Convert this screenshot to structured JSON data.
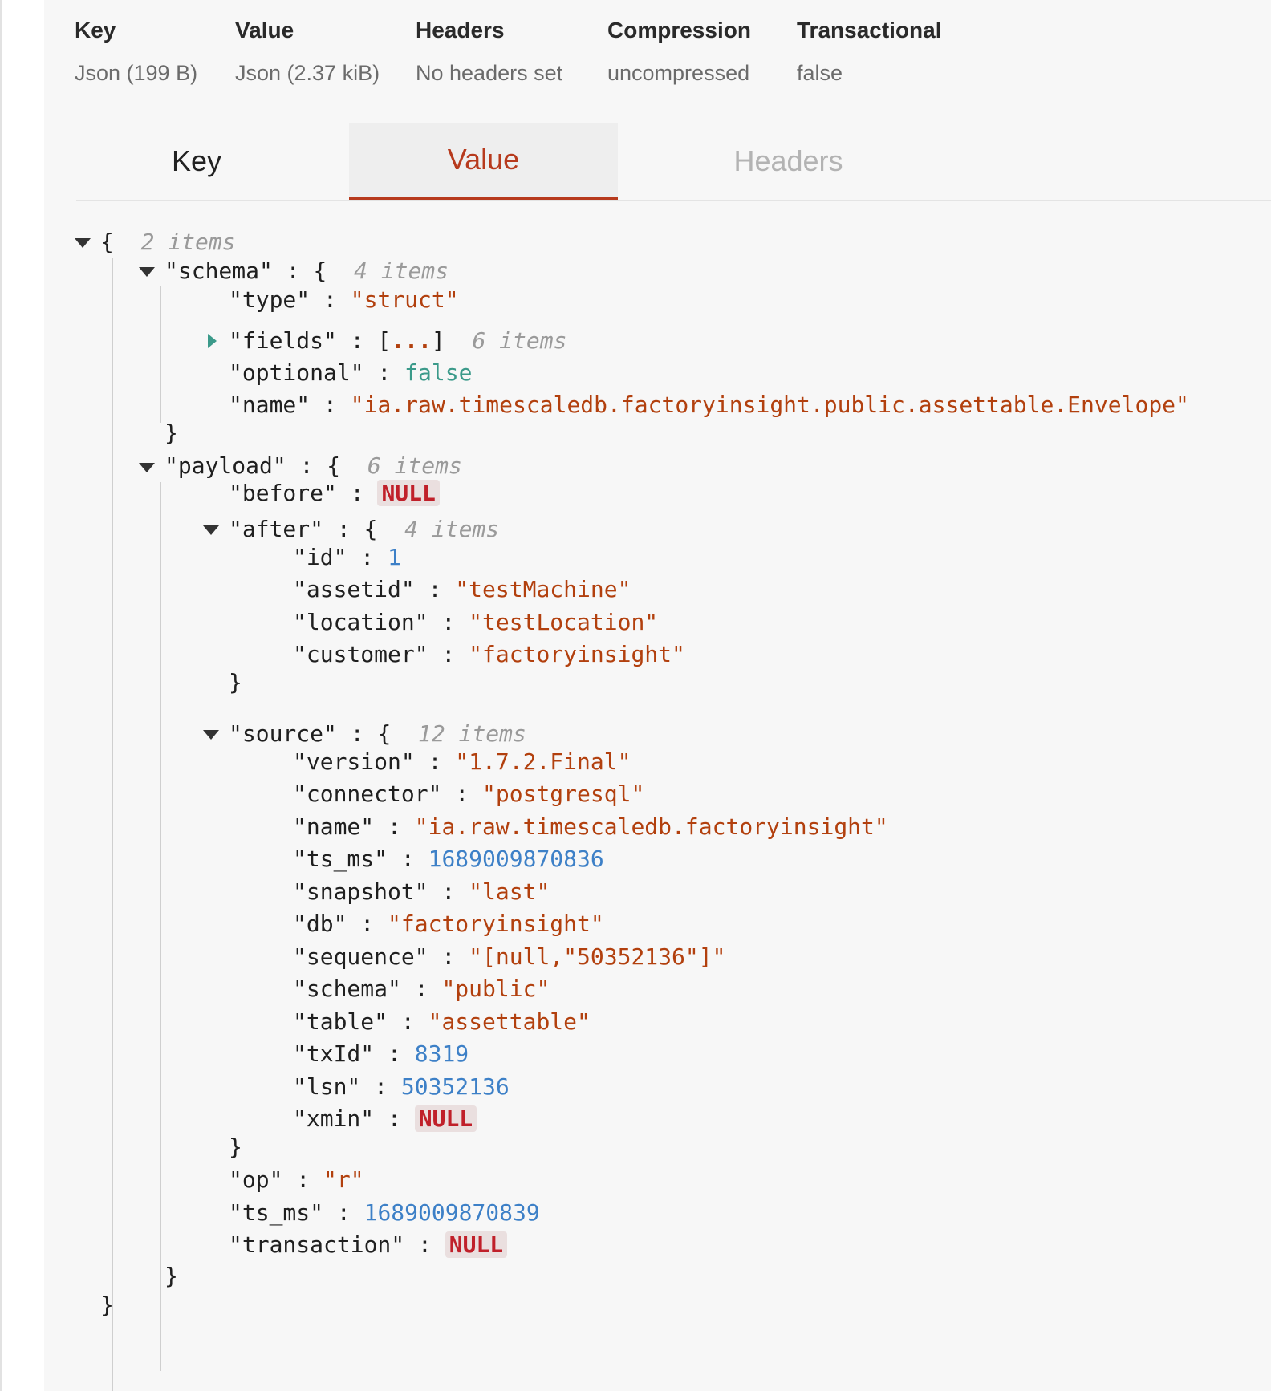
{
  "meta": {
    "columns": [
      {
        "label": "Key",
        "value": "Json (199 B)"
      },
      {
        "label": "Value",
        "value": "Json (2.37 kiB)"
      },
      {
        "label": "Headers",
        "value": "No headers set"
      },
      {
        "label": "Compression",
        "value": "uncompressed"
      },
      {
        "label": "Transactional",
        "value": "false"
      }
    ]
  },
  "tabs": {
    "key_label": "Key",
    "value_label": "Value",
    "headers_label": "Headers",
    "active": "Value"
  },
  "tree": {
    "root": {
      "open": "{",
      "count": "2 items",
      "close": "}"
    },
    "schema": {
      "key": "\"schema\"",
      "open": "{",
      "count": "4 items",
      "close": "}",
      "type_key": "\"type\"",
      "type_val": "\"struct\"",
      "fields_key": "\"fields\"",
      "fields_val": "...",
      "fields_count": "6 items",
      "optional_key": "\"optional\"",
      "optional_val": "false",
      "name_key": "\"name\"",
      "name_val": "\"ia.raw.timescaledb.factoryinsight.public.assettable.Envelope\""
    },
    "payload": {
      "key": "\"payload\"",
      "open": "{",
      "count": "6 items",
      "close": "}",
      "before_key": "\"before\"",
      "before_val": "NULL",
      "after": {
        "key": "\"after\"",
        "open": "{",
        "count": "4 items",
        "close": "}",
        "id_key": "\"id\"",
        "id_val": "1",
        "assetid_key": "\"assetid\"",
        "assetid_val": "\"testMachine\"",
        "location_key": "\"location\"",
        "location_val": "\"testLocation\"",
        "customer_key": "\"customer\"",
        "customer_val": "\"factoryinsight\""
      },
      "source": {
        "key": "\"source\"",
        "open": "{",
        "count": "12 items",
        "close": "}",
        "version_key": "\"version\"",
        "version_val": "\"1.7.2.Final\"",
        "connector_key": "\"connector\"",
        "connector_val": "\"postgresql\"",
        "name_key": "\"name\"",
        "name_val": "\"ia.raw.timescaledb.factoryinsight\"",
        "ts_ms_key": "\"ts_ms\"",
        "ts_ms_val": "1689009870836",
        "snapshot_key": "\"snapshot\"",
        "snapshot_val": "\"last\"",
        "db_key": "\"db\"",
        "db_val": "\"factoryinsight\"",
        "sequence_key": "\"sequence\"",
        "sequence_val": "\"[null,\"50352136\"]\"",
        "schema_key": "\"schema\"",
        "schema_val": "\"public\"",
        "table_key": "\"table\"",
        "table_val": "\"assettable\"",
        "txId_key": "\"txId\"",
        "txId_val": "8319",
        "lsn_key": "\"lsn\"",
        "lsn_val": "50352136",
        "xmin_key": "\"xmin\"",
        "xmin_val": "NULL"
      },
      "op_key": "\"op\"",
      "op_val": "\"r\"",
      "ts_ms_key": "\"ts_ms\"",
      "ts_ms_val": "1689009870839",
      "transaction_key": "\"transaction\"",
      "transaction_val": "NULL"
    }
  },
  "colors": {
    "accent": "#b73a1d",
    "string": "#b2400e",
    "number": "#3d80c7",
    "boolean": "#3b9a8a",
    "null": "#c0202a"
  },
  "icons": [
    "caret-down-icon",
    "caret-right-icon"
  ]
}
